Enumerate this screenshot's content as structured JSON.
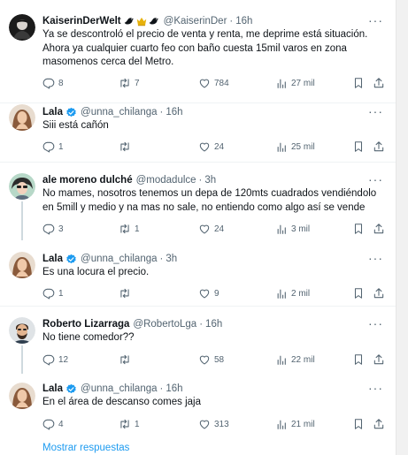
{
  "tweets": [
    {
      "name": "KaiserinDerWelt",
      "handle": "@KaiserinDer",
      "separator": "·",
      "time": "16h",
      "verified": false,
      "name_emoji": [
        "bird-icon",
        "crown-icon",
        "bird-icon"
      ],
      "text": "Ya se descontroló el precio de venta y renta, me deprime está situación. Ahora ya cualquier cuarto feo con baño cuesta 15mil varos en zona masomenos cerca del Metro.",
      "replies": "8",
      "retweets": "7",
      "likes": "784",
      "views": "27 mil"
    },
    {
      "name": "Lala",
      "handle": "@unna_chilanga",
      "separator": "·",
      "time": "16h",
      "verified": true,
      "text": "Siii está cañón",
      "replies": "1",
      "retweets": "",
      "likes": "24",
      "views": "25 mil"
    },
    {
      "name": "ale moreno dulché",
      "handle": "@modadulce",
      "separator": "·",
      "time": "3h",
      "verified": false,
      "text": "No mames, nosotros tenemos un depa de 120mts cuadrados vendiéndolo en 5mill y medio y na mas no sale, no entiendo como algo así se vende",
      "replies": "3",
      "retweets": "1",
      "likes": "24",
      "views": "3 mil"
    },
    {
      "name": "Lala",
      "handle": "@unna_chilanga",
      "separator": "·",
      "time": "3h",
      "verified": true,
      "text": "Es una locura el precio.",
      "replies": "1",
      "retweets": "",
      "likes": "9",
      "views": "2 mil"
    },
    {
      "name": "Roberto Lizarraga",
      "handle": "@RobertoLga",
      "separator": "·",
      "time": "16h",
      "verified": false,
      "text": "No tiene comedor??",
      "replies": "12",
      "retweets": "",
      "likes": "58",
      "views": "22 mil"
    },
    {
      "name": "Lala",
      "handle": "@unna_chilanga",
      "separator": "·",
      "time": "16h",
      "verified": true,
      "text": "En el área de descanso comes jaja",
      "replies": "4",
      "retweets": "1",
      "likes": "313",
      "views": "21 mil"
    }
  ],
  "show_more": "Mostrar respuestas",
  "colors": {
    "text": "#0f1419",
    "muted": "#536471",
    "accent": "#1d9bf0",
    "separator": "#eff3f4",
    "premium_gold": "#e7b10a"
  },
  "icons": {
    "reply": "reply-icon",
    "retweet": "retweet-icon",
    "like": "heart-icon",
    "views": "views-icon",
    "bookmark": "bookmark-icon",
    "share": "share-icon",
    "more": "more-icon",
    "verified": "verified-badge-icon"
  }
}
